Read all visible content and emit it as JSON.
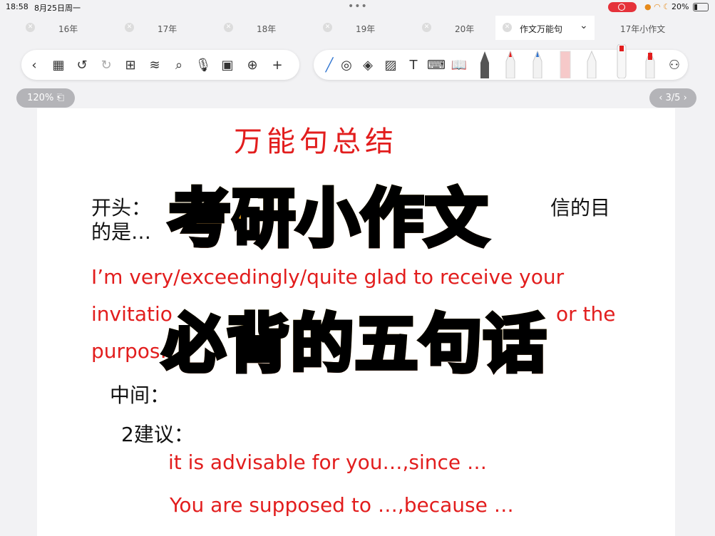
{
  "status": {
    "time": "18:58",
    "date": "8月25日周一",
    "dots": "•••",
    "battery_pct": "20%"
  },
  "tabs": [
    {
      "label": "16年"
    },
    {
      "label": "17年"
    },
    {
      "label": "18年"
    },
    {
      "label": "19年"
    },
    {
      "label": "20年"
    },
    {
      "label": "作文万能句",
      "active": true
    },
    {
      "label": "17年小作文"
    }
  ],
  "toolbar": {
    "left_icons": [
      "back-icon",
      "grid-icon",
      "undo-icon",
      "redo-icon",
      "add-page-icon",
      "layers-icon",
      "search-icon",
      "mic-icon",
      "clipboard-icon",
      "globe-icon",
      "plus-icon"
    ],
    "right_icons": [
      "pen-tool-icon",
      "lasso-icon",
      "eraser-icon",
      "image-icon",
      "text-icon",
      "keyboard-icon",
      "book-icon"
    ]
  },
  "zoom_label": "120%",
  "page_indicator": "3/5",
  "doc": {
    "heading": "万能句总结",
    "opening_label": "开头：",
    "opening_tail_1": "信的目",
    "opening_line2": "的是…",
    "red_line1": "I’m very/exceedingly/quite glad to receive your",
    "red_line2_start": "invitatio",
    "red_line2_end": "or the",
    "red_line3": "purpos…",
    "middle_label": "中间：",
    "suggest_label": "2建议：",
    "sentence1": "it is advisable for you…,since …",
    "sentence2": "You are supposed to …,because …"
  },
  "overlay": {
    "line1": "考研小作文",
    "line2": "必背的五句话"
  },
  "colors": {
    "accent_red": "#e21d1d",
    "overlay_yellow": "#ffd71a",
    "overlay_orange": "#ff5a10"
  }
}
